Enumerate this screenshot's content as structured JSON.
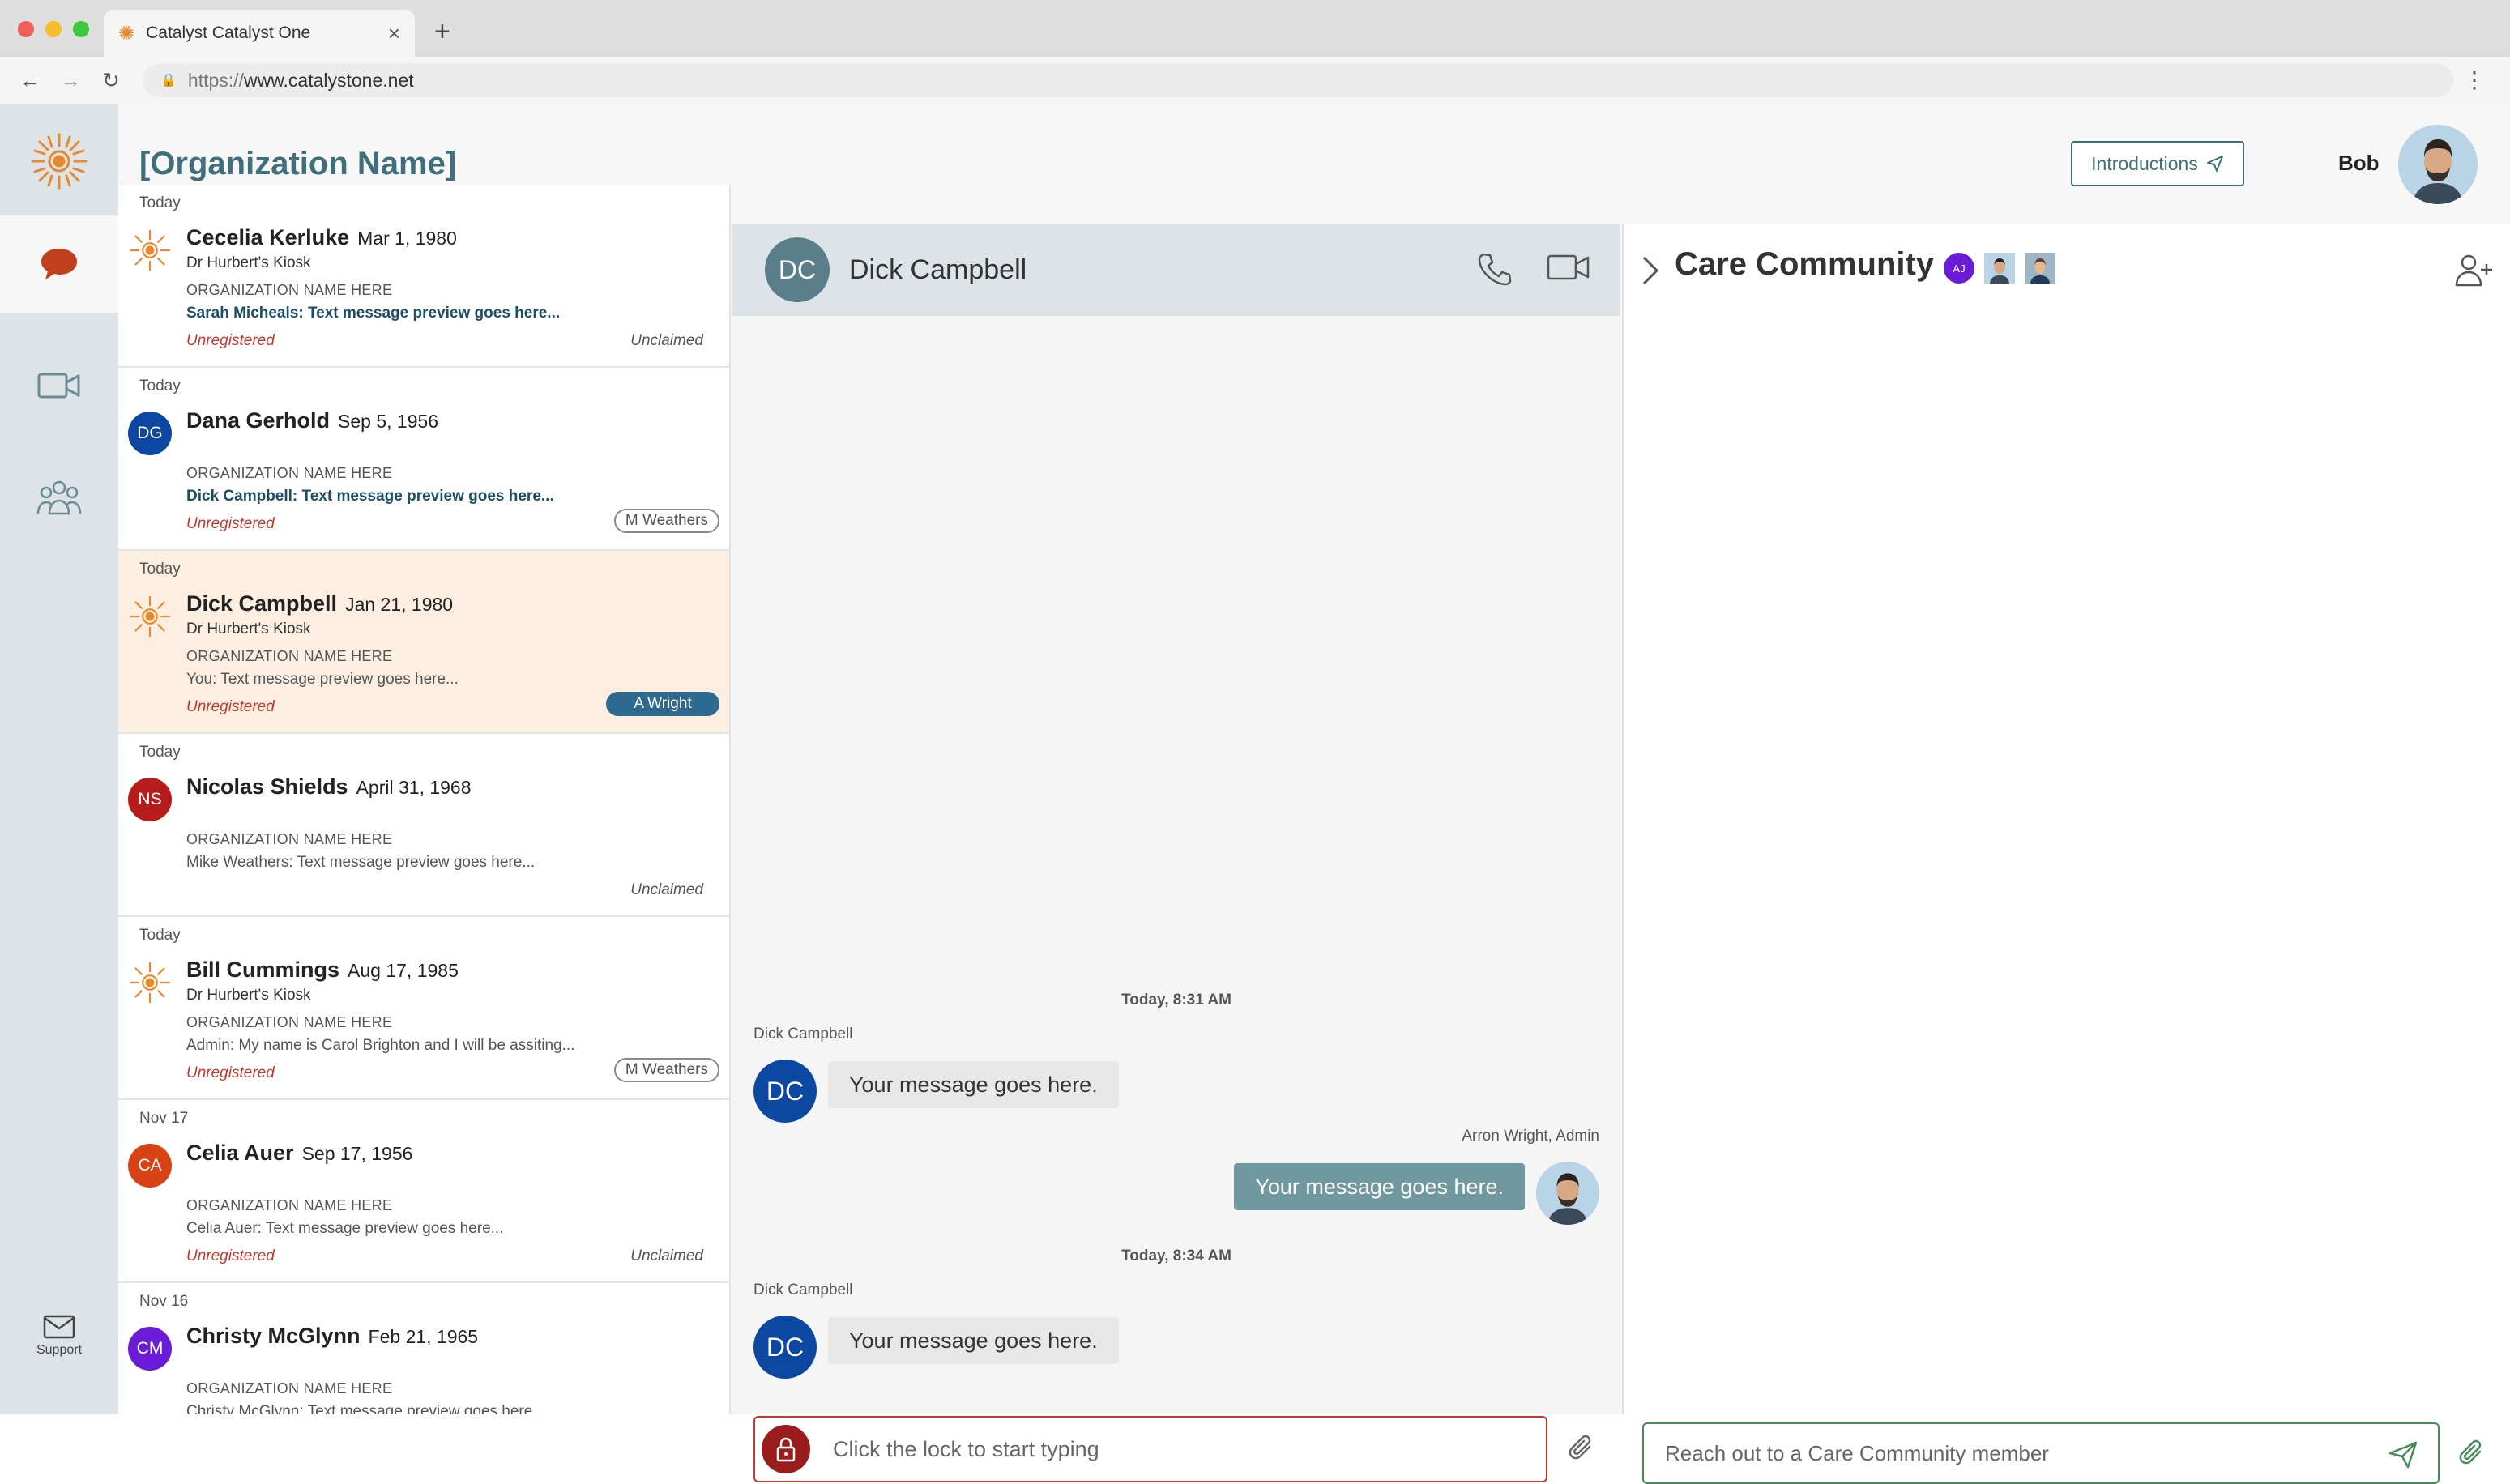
{
  "browser": {
    "tab_title": "Catalyst Catalyst One",
    "tab_close": "×",
    "new_tab": "+",
    "url_prefix": "https://",
    "url_domain": "www.catalystone.net"
  },
  "header": {
    "org_name": "[Organization Name]",
    "introductions_label": "Introductions",
    "user_name": "Bob"
  },
  "rail": {
    "support_label": "Support"
  },
  "conversations": [
    {
      "date": "Today",
      "name": "Cecelia Kerluke",
      "dob": "Mar 1, 1980",
      "kiosk": "Dr Hurbert's Kiosk",
      "org": "ORGANIZATION NAME HERE",
      "preview": "Sarah Micheals: Text message preview goes here...",
      "status": "Unregistered",
      "claim": "Unclaimed",
      "avatar": "logo"
    },
    {
      "date": "Today",
      "name": "Dana Gerhold",
      "dob": "Sep 5, 1956",
      "kiosk": "",
      "org": "ORGANIZATION NAME HERE",
      "preview": "Dick Campbell: Text message preview goes here...",
      "status": "Unregistered",
      "tag": "M Weathers",
      "initials": "DG",
      "color": "#0c47a1"
    },
    {
      "date": "Today",
      "name": "Dick Campbell",
      "dob": "Jan 21, 1980",
      "kiosk": "Dr Hurbert's Kiosk",
      "org": "ORGANIZATION NAME HERE",
      "preview": "You: Text message preview goes here...",
      "status": "Unregistered",
      "tag": "A Wright",
      "avatar": "logo"
    },
    {
      "date": "Today",
      "name": "Nicolas Shields",
      "dob": "April 31, 1968",
      "kiosk": "",
      "org": "ORGANIZATION NAME HERE",
      "preview": "Mike Weathers: Text message preview goes here...",
      "status": "",
      "claim": "Unclaimed",
      "initials": "NS",
      "color": "#b71c1c"
    },
    {
      "date": "Today",
      "name": "Bill Cummings",
      "dob": "Aug 17, 1985",
      "kiosk": "Dr Hurbert's Kiosk",
      "org": "ORGANIZATION NAME HERE",
      "preview": "Admin: My name is Carol Brighton and I will be assiting...",
      "status": "Unregistered",
      "tag": "M Weathers",
      "avatar": "logo"
    },
    {
      "date": "Nov 17",
      "name": "Celia Auer",
      "dob": "Sep 17, 1956",
      "kiosk": "",
      "org": "ORGANIZATION NAME HERE",
      "preview": "Celia Auer: Text message preview goes here...",
      "status": "Unregistered",
      "claim": "Unclaimed",
      "initials": "CA",
      "color": "#d84315"
    },
    {
      "date": "Nov 16",
      "name": "Christy McGlynn",
      "dob": "Feb 21, 1965",
      "kiosk": "",
      "org": "ORGANIZATION NAME HERE",
      "preview": "Christy McGlynn: Text message preview goes here...",
      "status": "",
      "initials": "CM",
      "color": "#6a1bd6"
    }
  ],
  "chat": {
    "contact_initials": "DC",
    "contact_name": "Dick Campbell",
    "ts1": "Today, 8:31 AM",
    "sender1": "Dick Campbell",
    "msg1": "Your message goes here.",
    "sender2": "Arron Wright,  Admin",
    "msg2": "Your message goes here.",
    "ts2": "Today, 8:34 AM",
    "sender3": "Dick Campbell",
    "msg3": "Your message goes here.",
    "msg_initials": "DC",
    "composer_placeholder": "Click the lock to start typing"
  },
  "care": {
    "title": "Care Community",
    "member1_initials": "AJ",
    "composer_placeholder": "Reach out to a Care Community member"
  },
  "colors": {
    "accent": "#3e6f7a",
    "warning": "#c0392b",
    "selected_row": "#fcefe2",
    "outgoing_bubble": "#6f999f"
  }
}
